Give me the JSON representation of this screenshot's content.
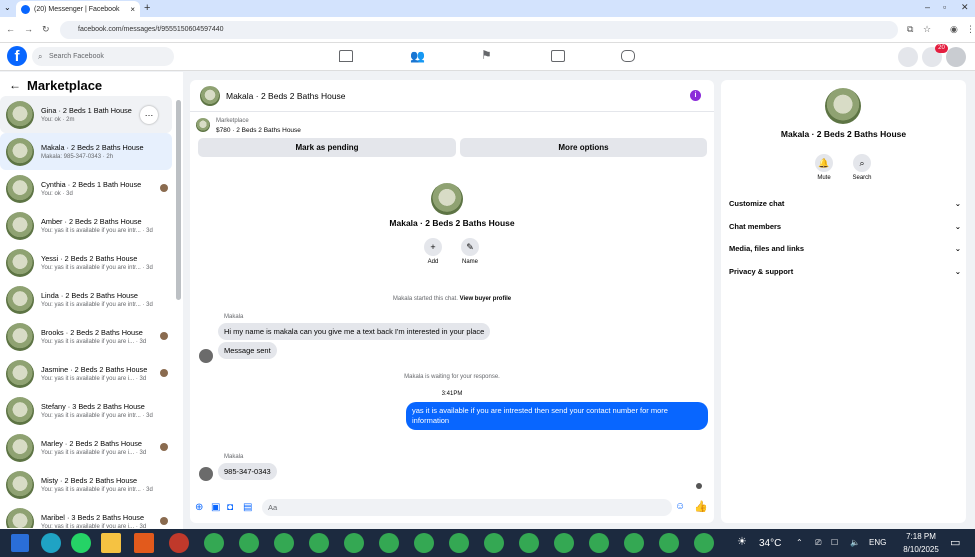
{
  "browser": {
    "tab_title": "(20) Messenger | Facebook",
    "url": "facebook.com/messages/t/9555150604597440"
  },
  "fb": {
    "search_placeholder": "Search Facebook",
    "notif_count": "20"
  },
  "left": {
    "title": "Marketplace",
    "conversations": [
      {
        "title": "Gina · 2 Beds 1 Bath House",
        "sub": "You: ok · 2m"
      },
      {
        "title": "Makala · 2 Beds 2 Baths House",
        "sub": "Makala: 985-347-0343 · 2h"
      },
      {
        "title": "Cynthia · 2 Beds 1 Bath House",
        "sub": "You: ok · 3d"
      },
      {
        "title": "Amber · 2 Beds 2 Baths House",
        "sub": "You: yas it is available if you are intr... · 3d"
      },
      {
        "title": "Yessi · 2 Beds 2 Baths House",
        "sub": "You: yas it is available if you are intr... · 3d"
      },
      {
        "title": "Linda · 2 Beds 2 Baths House",
        "sub": "You: yas it is available if you are intr... · 3d"
      },
      {
        "title": "Brooks · 2 Beds 2 Baths House",
        "sub": "You: yas it is available if you are i... · 3d"
      },
      {
        "title": "Jasmine · 2 Beds 2 Baths House",
        "sub": "You: yas it is available if you are i... · 3d"
      },
      {
        "title": "Stefany · 3 Beds 2 Baths House",
        "sub": "You: yas it is available if you are intr... · 3d"
      },
      {
        "title": "Marley · 2 Beds 2 Baths House",
        "sub": "You: yas it is available if you are i... · 3d"
      },
      {
        "title": "Misty · 2 Beds 2 Baths House",
        "sub": "You: yas it is available if you are intr... · 3d"
      },
      {
        "title": "Maribel · 3 Beds 2 Baths House",
        "sub": "You: yas it is available if you are i... · 3d"
      }
    ]
  },
  "chat": {
    "title": "Makala · 2 Beds 2 Baths House",
    "market_label": "Marketplace",
    "listing": "$780 · 2 Beds 2 Baths House",
    "mark_pending": "Mark as pending",
    "more_options": "More options",
    "profile_name": "Makala · 2 Beds 2 Baths House",
    "add": "Add",
    "name": "Name",
    "started": "Makala started this chat.",
    "view_profile": "View buyer profile",
    "sender": "Makala",
    "msg1": "Hi my name is makala can you give me a text back I'm interested in your place",
    "msg2": "Message sent",
    "waiting": "Makala is waiting for your response.",
    "time": "3:41PM",
    "reply": "yas it is available if you are intrested then send your contact number for more information",
    "sender2": "Makala",
    "msg3": "985-347-0343",
    "input_placeholder": "Aa"
  },
  "right": {
    "name": "Makala · 2 Beds 2 Baths House",
    "mute": "Mute",
    "search": "Search",
    "sections": [
      "Customize chat",
      "Chat members",
      "Media, files and links",
      "Privacy & support"
    ]
  },
  "taskbar": {
    "temp": "34°C",
    "lang": "ENG",
    "time": "7:18 PM",
    "date": "8/10/2025"
  }
}
